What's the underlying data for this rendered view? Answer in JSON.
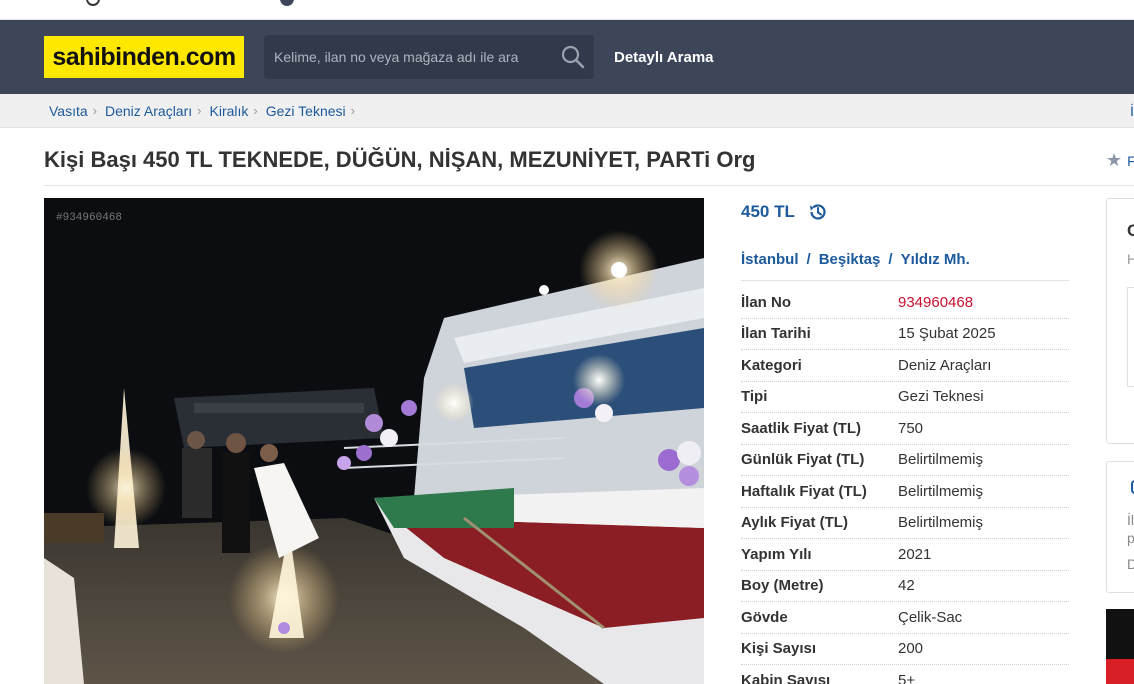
{
  "header": {
    "logo_text": "sahibinden.com",
    "search_placeholder": "Kelime, ilan no veya mağaza adı ile ara",
    "advanced_search_label": "Detaylı Arama"
  },
  "breadcrumb": [
    "Vasıta",
    "Deniz Araçları",
    "Kiralık",
    "Gezi Teknesi"
  ],
  "listing": {
    "title": "Kişi Başı 450 TL TEKNEDE, DÜĞÜN, NİŞAN, MEZUNİYET, PARTi Org",
    "favorite_label": "F",
    "photo_watermark_id": "#934960468",
    "price": "450 TL",
    "location": [
      "İstanbul",
      "Beşiktaş",
      "Yıldız Mh."
    ],
    "specs": [
      {
        "key": "İlan No",
        "value": "934960468",
        "highlight": true
      },
      {
        "key": "İlan Tarihi",
        "value": "15 Şubat 2025"
      },
      {
        "key": "Kategori",
        "value": "Deniz Araçları"
      },
      {
        "key": "Tipi",
        "value": "Gezi Teknesi"
      },
      {
        "key": "Saatlik Fiyat (TL)",
        "value": "750"
      },
      {
        "key": "Günlük Fiyat (TL)",
        "value": "Belirtilmemiş"
      },
      {
        "key": "Haftalık Fiyat (TL)",
        "value": "Belirtilmemiş"
      },
      {
        "key": "Aylık Fiyat (TL)",
        "value": "Belirtilmemiş"
      },
      {
        "key": "Yapım Yılı",
        "value": "2021"
      },
      {
        "key": "Boy (Metre)",
        "value": "42"
      },
      {
        "key": "Gövde",
        "value": "Çelik-Sac"
      },
      {
        "key": "Kişi Sayısı",
        "value": "200"
      },
      {
        "key": "Kabin Sayısı",
        "value": "5+"
      }
    ]
  },
  "side_panels": {
    "panel1_initial": "C",
    "panel1_sub": "H",
    "panel2_lines": [
      "İl",
      "p",
      "D"
    ]
  },
  "colors": {
    "header_bg": "#3c4658",
    "logo_bg": "#ffe800",
    "link_blue": "#1d5a9c",
    "id_red": "#c8102e"
  }
}
